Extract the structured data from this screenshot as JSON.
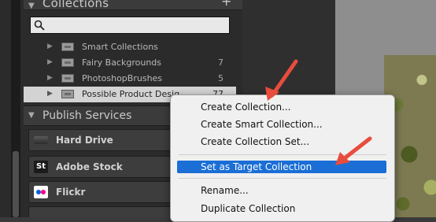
{
  "collections_panel": {
    "title": "Collections",
    "add_symbol": "+",
    "items": [
      {
        "label": "Smart Collections",
        "count": ""
      },
      {
        "label": "Fairy Backgrounds",
        "count": "7"
      },
      {
        "label": "PhotoshopBrushes",
        "count": "5"
      },
      {
        "label": "Possible Product Desig...",
        "count": "77"
      }
    ]
  },
  "publish_services": {
    "title": "Publish Services",
    "items": [
      {
        "label": "Hard Drive",
        "icon": "hard-drive-icon"
      },
      {
        "label": "Adobe Stock",
        "icon": "adobe-stock-icon",
        "icon_text": "St"
      },
      {
        "label": "Flickr",
        "icon": "flickr-icon"
      }
    ]
  },
  "context_menu": {
    "items": [
      "Create Collection...",
      "Create Smart Collection...",
      "Create Collection Set...",
      "Set as Target Collection",
      "Rename...",
      "Duplicate Collection"
    ],
    "highlighted_index": 3,
    "highlight_color": "#1a6ed6"
  },
  "annotation_color": "#e84c3d"
}
